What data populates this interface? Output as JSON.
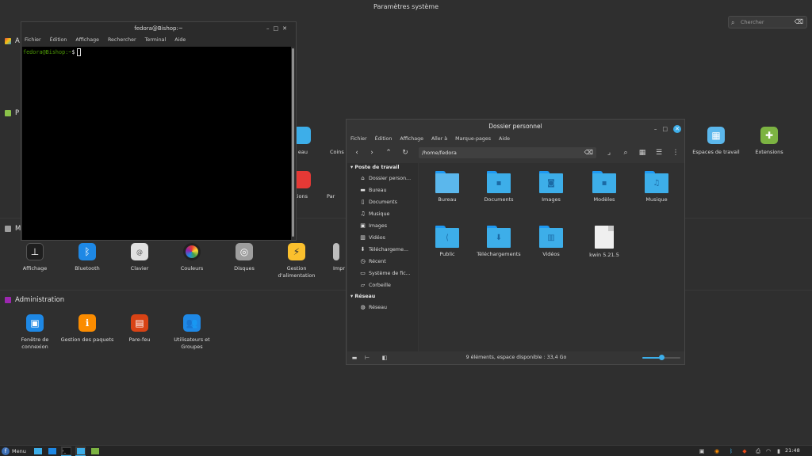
{
  "settings": {
    "title": "Paramètres système",
    "search_placeholder": "Chercher",
    "sections": {
      "s1_letter": "A",
      "s2_letter": "P",
      "s3_letter": "M",
      "administration": "Administration"
    },
    "row2_items": {
      "bureau_partial": "eau",
      "coins": "Coins ...",
      "workspaces": "Espaces de travail",
      "extensions": "Extensions"
    },
    "row3_items": {
      "notifications_partial": "cations",
      "par_partial": "Par"
    },
    "hardware_items": {
      "display": "Affichage",
      "bluetooth": "Bluetooth",
      "keyboard": "Clavier",
      "colors": "Couleurs",
      "disks": "Disques",
      "power": "Gestion d'alimentation",
      "print_partial": "Impr"
    },
    "admin_items": {
      "login_window": "Fenêtre de connexion",
      "packages": "Gestion des paquets",
      "firewall": "Pare-feu",
      "users": "Utilisateurs et Groupes"
    }
  },
  "terminal": {
    "title": "fedora@Bishop:~",
    "menu": [
      "Fichier",
      "Édition",
      "Affichage",
      "Rechercher",
      "Terminal",
      "Aide"
    ],
    "prompt_user": "fedora@Bishop:~",
    "prompt_suffix": "$"
  },
  "file_manager": {
    "title": "Dossier personnel",
    "menu": [
      "Fichier",
      "Édition",
      "Affichage",
      "Aller à",
      "Marque-pages",
      "Aide"
    ],
    "path": "/home/fedora",
    "sidebar": {
      "places_header": "Poste de travail",
      "places": [
        "Dossier person...",
        "Bureau",
        "Documents",
        "Musique",
        "Images",
        "Vidéos",
        "Téléchargeme...",
        "Récent",
        "Système de fic...",
        "Corbeille"
      ],
      "network_header": "Réseau",
      "network": [
        "Réseau"
      ]
    },
    "items": [
      "Bureau",
      "Documents",
      "Images",
      "Modèles",
      "Musique",
      "Public",
      "Téléchargements",
      "Vidéos",
      "kwin 5.21.5"
    ],
    "status": "9 éléments, espace disponible : 33,4 Go",
    "zoom_level": 0.5
  },
  "taskbar": {
    "menu_label": "Menu",
    "clock": "21:48"
  }
}
